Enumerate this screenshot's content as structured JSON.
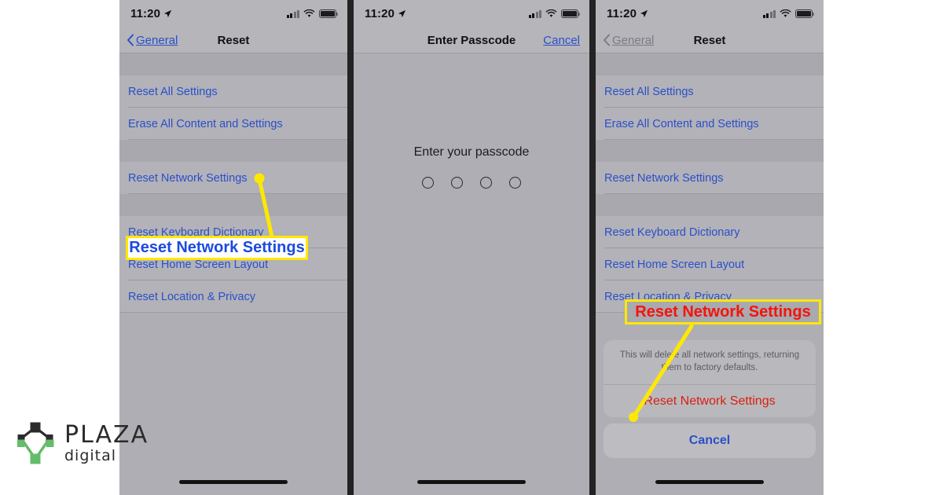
{
  "statusbar": {
    "time": "11:20",
    "location_icon": "location-arrow-icon",
    "signal_icon": "cellular-signal-icon",
    "wifi_icon": "wifi-icon",
    "battery_icon": "battery-icon"
  },
  "panel1": {
    "nav": {
      "back_label": "General",
      "back_icon": "chevron-left-icon",
      "title": "Reset"
    },
    "rows": [
      {
        "label": "Reset All Settings"
      },
      {
        "label": "Erase All Content and Settings"
      },
      {
        "label": "Reset Network Settings"
      },
      {
        "label": "Reset Keyboard Dictionary"
      },
      {
        "label": "Reset Home Screen Layout"
      },
      {
        "label": "Reset Location & Privacy"
      }
    ],
    "annotation": {
      "text": "Reset Network Settings",
      "text_color": "#1b4ae0",
      "background": "#ffffff",
      "border_color": "#ffe800"
    }
  },
  "panel2": {
    "nav": {
      "title": "Enter Passcode",
      "cancel_label": "Cancel"
    },
    "prompt": "Enter your passcode",
    "passcode_digits": 4
  },
  "panel3": {
    "nav": {
      "back_label": "General",
      "back_icon": "chevron-left-icon",
      "title": "Reset"
    },
    "rows": [
      {
        "label": "Reset All Settings"
      },
      {
        "label": "Erase All Content and Settings"
      },
      {
        "label": "Reset Network Settings"
      },
      {
        "label": "Reset Keyboard Dictionary"
      },
      {
        "label": "Reset Home Screen Layout"
      },
      {
        "label": "Reset Location & Privacy"
      }
    ],
    "action_sheet": {
      "message": "This will delete all network settings, returning them to factory defaults.",
      "destructive_label": "Reset Network Settings",
      "cancel_label": "Cancel",
      "destructive_color": "#d81f10",
      "cancel_color": "#2b4fc9"
    },
    "annotation": {
      "text": "Reset Network Settings",
      "text_color": "#f4140a",
      "background": "#a9a9af",
      "border_color": "#ffe800"
    }
  },
  "logo": {
    "word": "PLAZA",
    "sub": "digital",
    "mark_icon": "plaza-diamond-nodes-icon",
    "dark_color": "#2b2b2b",
    "accent_color": "#63bd6a"
  },
  "callout_color": "#ffe800"
}
